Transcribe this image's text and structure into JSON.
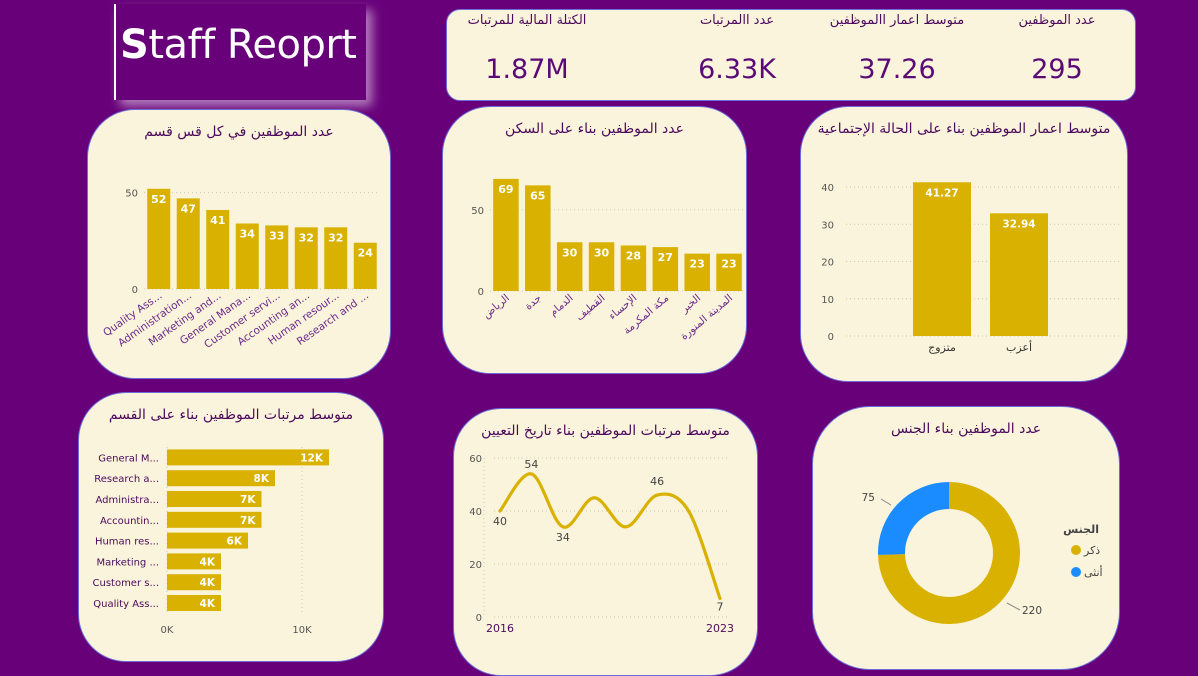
{
  "report_title": {
    "first_letter": "S",
    "rest": "taff Reoprt"
  },
  "kpis": [
    {
      "label": "الكتلة المالية للمرتبات",
      "value": "1.87M"
    },
    {
      "label": "عدد االمرتبات",
      "value": "6.33K"
    },
    {
      "label": "متوسط اعمار االموظفين",
      "value": "37.26"
    },
    {
      "label": "عدد الموظفين",
      "value": "295"
    }
  ],
  "colors": {
    "background": "#68007a",
    "card": "#fbf4dc",
    "gold": "#d9b100",
    "blue": "#1a8cff",
    "title_text": "#4b0a5c"
  },
  "chart_data": [
    {
      "id": "dept",
      "type": "bar",
      "title": "عدد الموظفين في كل قس قسم",
      "categories": [
        "Quality Ass...",
        "Administration...",
        "Marketing and...",
        "General Mana...",
        "Customer servi...",
        "Accounting an...",
        "Human resour...",
        "Research and ..."
      ],
      "values": [
        52,
        47,
        41,
        34,
        33,
        32,
        32,
        24
      ],
      "ylim": [
        0,
        55
      ],
      "yticks": [
        "0",
        "50"
      ]
    },
    {
      "id": "residence",
      "type": "bar",
      "title": "عدد الموظفين بناء على السكن",
      "categories": [
        "الرياض",
        "جدة",
        "الدمام",
        "القطيف",
        "الإحساء",
        "مكة المكرمة",
        "الخبر",
        "المدينة المنورة"
      ],
      "values": [
        69,
        65,
        30,
        30,
        28,
        27,
        23,
        23
      ],
      "ylim": [
        0,
        72
      ],
      "yticks": [
        "0",
        "50"
      ]
    },
    {
      "id": "marital",
      "type": "bar",
      "title": "متوسط اعمار الموظفين بناء على الحالة الإجتماعية",
      "categories": [
        "متزوج",
        "أعزب"
      ],
      "values": [
        41.27,
        32.94
      ],
      "labels": [
        "41.27",
        "32.94"
      ],
      "ylim": [
        0,
        40
      ],
      "yticks": [
        "0",
        "10",
        "20",
        "30",
        "40"
      ]
    },
    {
      "id": "salary_dept",
      "type": "bar",
      "orientation": "horizontal",
      "title": "متوسط مرتبات الموظفين بناء على القسم",
      "categories": [
        "General M...",
        "Research a...",
        "Administra...",
        "Accountin...",
        "Human res...",
        "Marketing ...",
        "Customer s...",
        "Quality Ass..."
      ],
      "values": [
        12000,
        8000,
        7000,
        7000,
        6000,
        4000,
        4000,
        4000
      ],
      "labels": [
        "12K",
        "8K",
        "7K",
        "7K",
        "6K",
        "4K",
        "4K",
        "4K"
      ],
      "xlim": [
        0,
        10000
      ],
      "xticks": [
        "0K",
        "10K"
      ]
    },
    {
      "id": "hire_year",
      "type": "line",
      "title": "متوسط مرتبات الموظفين بناء تاريخ التعيين",
      "x": [
        2016,
        2017,
        2018,
        2019,
        2020,
        2021,
        2022,
        2023
      ],
      "values": [
        40,
        54,
        34,
        45,
        34,
        46,
        40,
        7
      ],
      "point_labels": [
        "40",
        "54",
        "34",
        "",
        "",
        "46",
        "",
        "7"
      ],
      "xtick_labels": [
        "2016",
        "2023"
      ],
      "ylim": [
        0,
        60
      ],
      "yticks": [
        "0",
        "20",
        "40",
        "60"
      ]
    },
    {
      "id": "gender",
      "type": "pie",
      "title": "عدد الموظفين بناء الجنس",
      "legend_title": "الجنس",
      "categories": [
        "ذكر",
        "أنثى"
      ],
      "values": [
        220,
        75
      ],
      "labels": [
        "220",
        "75"
      ]
    }
  ]
}
